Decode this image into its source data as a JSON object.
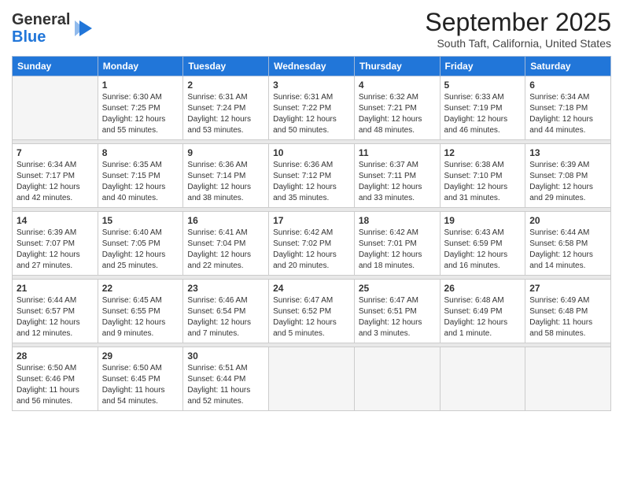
{
  "header": {
    "logo_general": "General",
    "logo_blue": "Blue",
    "month": "September 2025",
    "location": "South Taft, California, United States"
  },
  "weekdays": [
    "Sunday",
    "Monday",
    "Tuesday",
    "Wednesday",
    "Thursday",
    "Friday",
    "Saturday"
  ],
  "weeks": [
    [
      {
        "day": "",
        "sunrise": "",
        "sunset": "",
        "daylight": ""
      },
      {
        "day": "1",
        "sunrise": "Sunrise: 6:30 AM",
        "sunset": "Sunset: 7:25 PM",
        "daylight": "Daylight: 12 hours and 55 minutes."
      },
      {
        "day": "2",
        "sunrise": "Sunrise: 6:31 AM",
        "sunset": "Sunset: 7:24 PM",
        "daylight": "Daylight: 12 hours and 53 minutes."
      },
      {
        "day": "3",
        "sunrise": "Sunrise: 6:31 AM",
        "sunset": "Sunset: 7:22 PM",
        "daylight": "Daylight: 12 hours and 50 minutes."
      },
      {
        "day": "4",
        "sunrise": "Sunrise: 6:32 AM",
        "sunset": "Sunset: 7:21 PM",
        "daylight": "Daylight: 12 hours and 48 minutes."
      },
      {
        "day": "5",
        "sunrise": "Sunrise: 6:33 AM",
        "sunset": "Sunset: 7:19 PM",
        "daylight": "Daylight: 12 hours and 46 minutes."
      },
      {
        "day": "6",
        "sunrise": "Sunrise: 6:34 AM",
        "sunset": "Sunset: 7:18 PM",
        "daylight": "Daylight: 12 hours and 44 minutes."
      }
    ],
    [
      {
        "day": "7",
        "sunrise": "Sunrise: 6:34 AM",
        "sunset": "Sunset: 7:17 PM",
        "daylight": "Daylight: 12 hours and 42 minutes."
      },
      {
        "day": "8",
        "sunrise": "Sunrise: 6:35 AM",
        "sunset": "Sunset: 7:15 PM",
        "daylight": "Daylight: 12 hours and 40 minutes."
      },
      {
        "day": "9",
        "sunrise": "Sunrise: 6:36 AM",
        "sunset": "Sunset: 7:14 PM",
        "daylight": "Daylight: 12 hours and 38 minutes."
      },
      {
        "day": "10",
        "sunrise": "Sunrise: 6:36 AM",
        "sunset": "Sunset: 7:12 PM",
        "daylight": "Daylight: 12 hours and 35 minutes."
      },
      {
        "day": "11",
        "sunrise": "Sunrise: 6:37 AM",
        "sunset": "Sunset: 7:11 PM",
        "daylight": "Daylight: 12 hours and 33 minutes."
      },
      {
        "day": "12",
        "sunrise": "Sunrise: 6:38 AM",
        "sunset": "Sunset: 7:10 PM",
        "daylight": "Daylight: 12 hours and 31 minutes."
      },
      {
        "day": "13",
        "sunrise": "Sunrise: 6:39 AM",
        "sunset": "Sunset: 7:08 PM",
        "daylight": "Daylight: 12 hours and 29 minutes."
      }
    ],
    [
      {
        "day": "14",
        "sunrise": "Sunrise: 6:39 AM",
        "sunset": "Sunset: 7:07 PM",
        "daylight": "Daylight: 12 hours and 27 minutes."
      },
      {
        "day": "15",
        "sunrise": "Sunrise: 6:40 AM",
        "sunset": "Sunset: 7:05 PM",
        "daylight": "Daylight: 12 hours and 25 minutes."
      },
      {
        "day": "16",
        "sunrise": "Sunrise: 6:41 AM",
        "sunset": "Sunset: 7:04 PM",
        "daylight": "Daylight: 12 hours and 22 minutes."
      },
      {
        "day": "17",
        "sunrise": "Sunrise: 6:42 AM",
        "sunset": "Sunset: 7:02 PM",
        "daylight": "Daylight: 12 hours and 20 minutes."
      },
      {
        "day": "18",
        "sunrise": "Sunrise: 6:42 AM",
        "sunset": "Sunset: 7:01 PM",
        "daylight": "Daylight: 12 hours and 18 minutes."
      },
      {
        "day": "19",
        "sunrise": "Sunrise: 6:43 AM",
        "sunset": "Sunset: 6:59 PM",
        "daylight": "Daylight: 12 hours and 16 minutes."
      },
      {
        "day": "20",
        "sunrise": "Sunrise: 6:44 AM",
        "sunset": "Sunset: 6:58 PM",
        "daylight": "Daylight: 12 hours and 14 minutes."
      }
    ],
    [
      {
        "day": "21",
        "sunrise": "Sunrise: 6:44 AM",
        "sunset": "Sunset: 6:57 PM",
        "daylight": "Daylight: 12 hours and 12 minutes."
      },
      {
        "day": "22",
        "sunrise": "Sunrise: 6:45 AM",
        "sunset": "Sunset: 6:55 PM",
        "daylight": "Daylight: 12 hours and 9 minutes."
      },
      {
        "day": "23",
        "sunrise": "Sunrise: 6:46 AM",
        "sunset": "Sunset: 6:54 PM",
        "daylight": "Daylight: 12 hours and 7 minutes."
      },
      {
        "day": "24",
        "sunrise": "Sunrise: 6:47 AM",
        "sunset": "Sunset: 6:52 PM",
        "daylight": "Daylight: 12 hours and 5 minutes."
      },
      {
        "day": "25",
        "sunrise": "Sunrise: 6:47 AM",
        "sunset": "Sunset: 6:51 PM",
        "daylight": "Daylight: 12 hours and 3 minutes."
      },
      {
        "day": "26",
        "sunrise": "Sunrise: 6:48 AM",
        "sunset": "Sunset: 6:49 PM",
        "daylight": "Daylight: 12 hours and 1 minute."
      },
      {
        "day": "27",
        "sunrise": "Sunrise: 6:49 AM",
        "sunset": "Sunset: 6:48 PM",
        "daylight": "Daylight: 11 hours and 58 minutes."
      }
    ],
    [
      {
        "day": "28",
        "sunrise": "Sunrise: 6:50 AM",
        "sunset": "Sunset: 6:46 PM",
        "daylight": "Daylight: 11 hours and 56 minutes."
      },
      {
        "day": "29",
        "sunrise": "Sunrise: 6:50 AM",
        "sunset": "Sunset: 6:45 PM",
        "daylight": "Daylight: 11 hours and 54 minutes."
      },
      {
        "day": "30",
        "sunrise": "Sunrise: 6:51 AM",
        "sunset": "Sunset: 6:44 PM",
        "daylight": "Daylight: 11 hours and 52 minutes."
      },
      {
        "day": "",
        "sunrise": "",
        "sunset": "",
        "daylight": ""
      },
      {
        "day": "",
        "sunrise": "",
        "sunset": "",
        "daylight": ""
      },
      {
        "day": "",
        "sunrise": "",
        "sunset": "",
        "daylight": ""
      },
      {
        "day": "",
        "sunrise": "",
        "sunset": "",
        "daylight": ""
      }
    ]
  ]
}
